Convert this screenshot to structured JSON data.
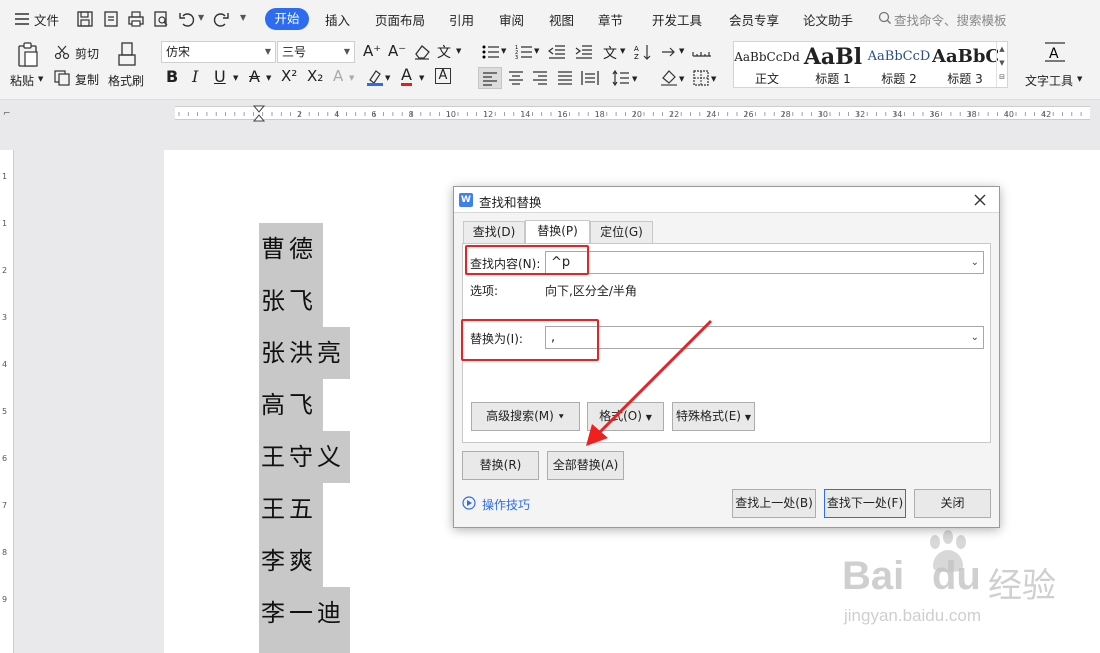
{
  "menubar": {
    "file": "文件",
    "tabs": [
      "开始",
      "插入",
      "页面布局",
      "引用",
      "审阅",
      "视图",
      "章节",
      "开发工具",
      "会员专享",
      "论文助手"
    ],
    "search": "查找命令、搜索模板"
  },
  "ribbon": {
    "paste": "粘贴",
    "cut": "剪切",
    "copy": "复制",
    "format_painter": "格式刷",
    "font_name": "仿宋",
    "font_size": "三号",
    "styles": [
      {
        "preview": "AaBbCcDd",
        "name": "正文"
      },
      {
        "preview": "AaBl",
        "name": "标题 1"
      },
      {
        "preview": "AaBbCcD",
        "name": "标题 2"
      },
      {
        "preview": "AaBbC",
        "name": "标题 3"
      }
    ],
    "text_tools": "文字工具"
  },
  "ruler": {
    "numbers": [
      "2",
      "4",
      "6",
      "8",
      "10",
      "12",
      "14",
      "16",
      "18",
      "20",
      "22",
      "24",
      "26",
      "28",
      "30",
      "32",
      "34",
      "36",
      "38",
      "40",
      "42"
    ]
  },
  "vruler": {
    "numbers": [
      "1",
      "1",
      "2",
      "3",
      "4",
      "5",
      "6",
      "7",
      "8",
      "9"
    ]
  },
  "document": {
    "lines": [
      "曹德",
      "张飞",
      "张洪亮",
      "高飞",
      "王守义",
      "王五",
      "李爽",
      "李一迪"
    ]
  },
  "dialog": {
    "title": "查找和替换",
    "tabs": [
      "查找(D)",
      "替换(P)",
      "定位(G)"
    ],
    "find_label": "查找内容(N):",
    "find_value": "^p",
    "options_label": "选项:",
    "options_value": "向下,区分全/半角",
    "replace_label": "替换为(I):",
    "replace_value": ",",
    "advanced_search": "高级搜索(M)",
    "format": "格式(O)",
    "special_format": "特殊格式(E)",
    "replace_btn": "替换(R)",
    "replace_all_btn": "全部替换(A)",
    "tips": "操作技巧",
    "find_prev": "查找上一处(B)",
    "find_next": "查找下一处(F)",
    "close": "关闭"
  },
  "watermark": {
    "brand": "Bai",
    "brand2": "du",
    "cn": "经验",
    "url": "jingyan.baidu.com"
  },
  "colors": {
    "accent": "#2d6bf0",
    "annotation": "#f02020",
    "highlight": "#c8c8c8"
  }
}
